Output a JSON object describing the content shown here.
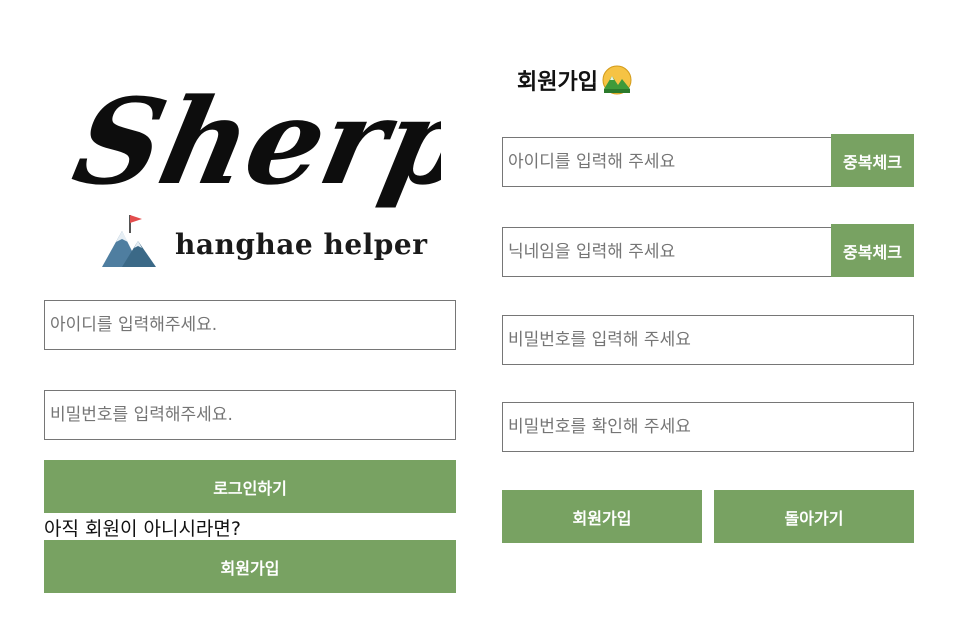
{
  "logo": {
    "script_text": "Sherpa",
    "subtitle": "hanghae helper"
  },
  "login": {
    "id_placeholder": "아이디를 입력해주세요.",
    "password_placeholder": "비밀번호를 입력해주세요.",
    "login_button": "로그인하기",
    "no_account_text": "아직 회원이 아니시라면?",
    "signup_button": "회원가입"
  },
  "signup": {
    "title": "회원가입",
    "title_icon": "mountain-sunrise-icon",
    "id_placeholder": "아이디를 입력해 주세요",
    "id_check_button": "중복체크",
    "nickname_placeholder": "닉네임을 입력해 주세요",
    "nickname_check_button": "중복체크",
    "password_placeholder": "비밀번호를 입력해 주세요",
    "password_confirm_placeholder": "비밀번호를 확인해 주세요",
    "submit_button": "회원가입",
    "back_button": "돌아가기"
  },
  "colors": {
    "accent": "#78a262",
    "border": "#767676"
  }
}
